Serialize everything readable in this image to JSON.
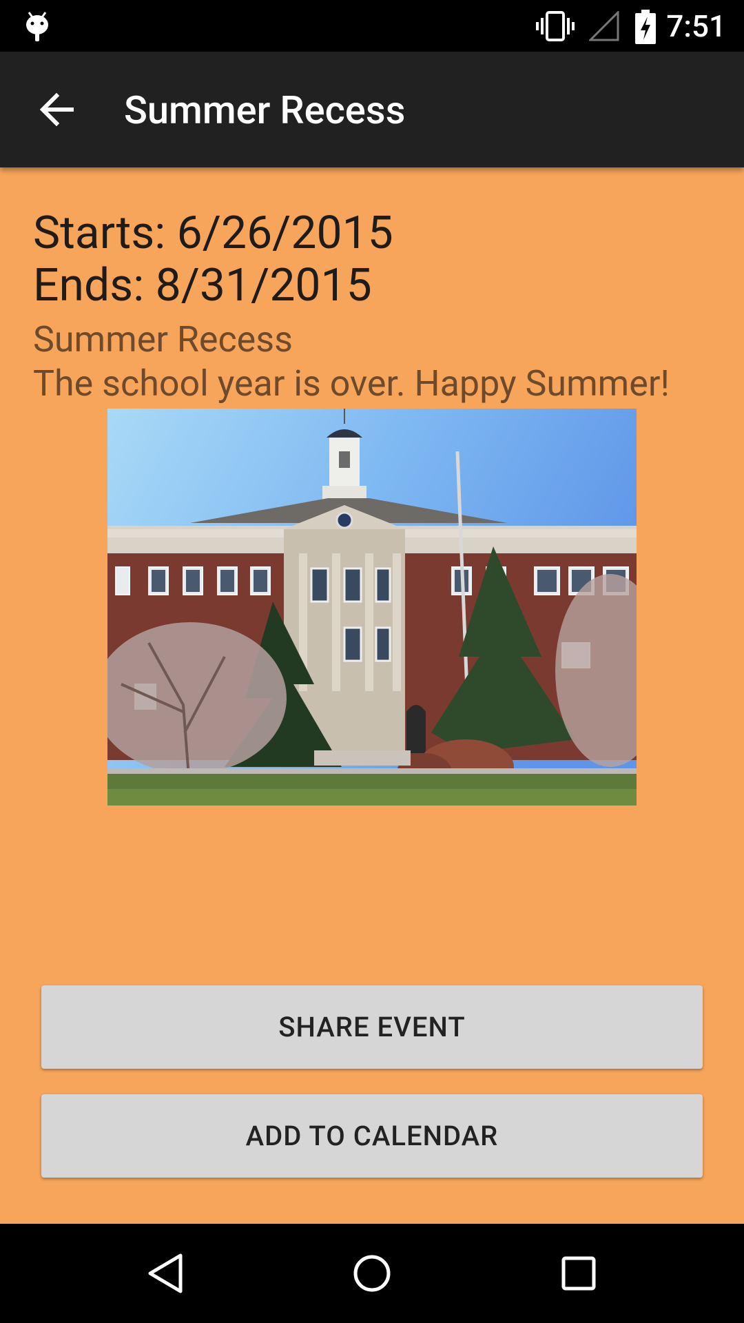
{
  "status_bar": {
    "time": "7:51",
    "icons": [
      "android-icon",
      "vibrate-icon",
      "signal-icon",
      "battery-charging-icon"
    ]
  },
  "app_bar": {
    "title": "Summer Recess",
    "back_icon": "arrow-back-icon"
  },
  "event": {
    "starts": "Starts: 6/26/2015",
    "ends": "Ends: 8/31/2015",
    "name": "Summer Recess",
    "description": "The school year is over. Happy Summer!"
  },
  "buttons": {
    "share": "SHARE EVENT",
    "add_to_calendar": "ADD TO CALENDAR"
  },
  "nav_bar": {
    "icons": [
      "nav-back-icon",
      "nav-home-icon",
      "nav-recents-icon"
    ]
  },
  "colors": {
    "background": "#f7a55a",
    "app_bar": "#212121",
    "button": "#d6d6d6"
  }
}
